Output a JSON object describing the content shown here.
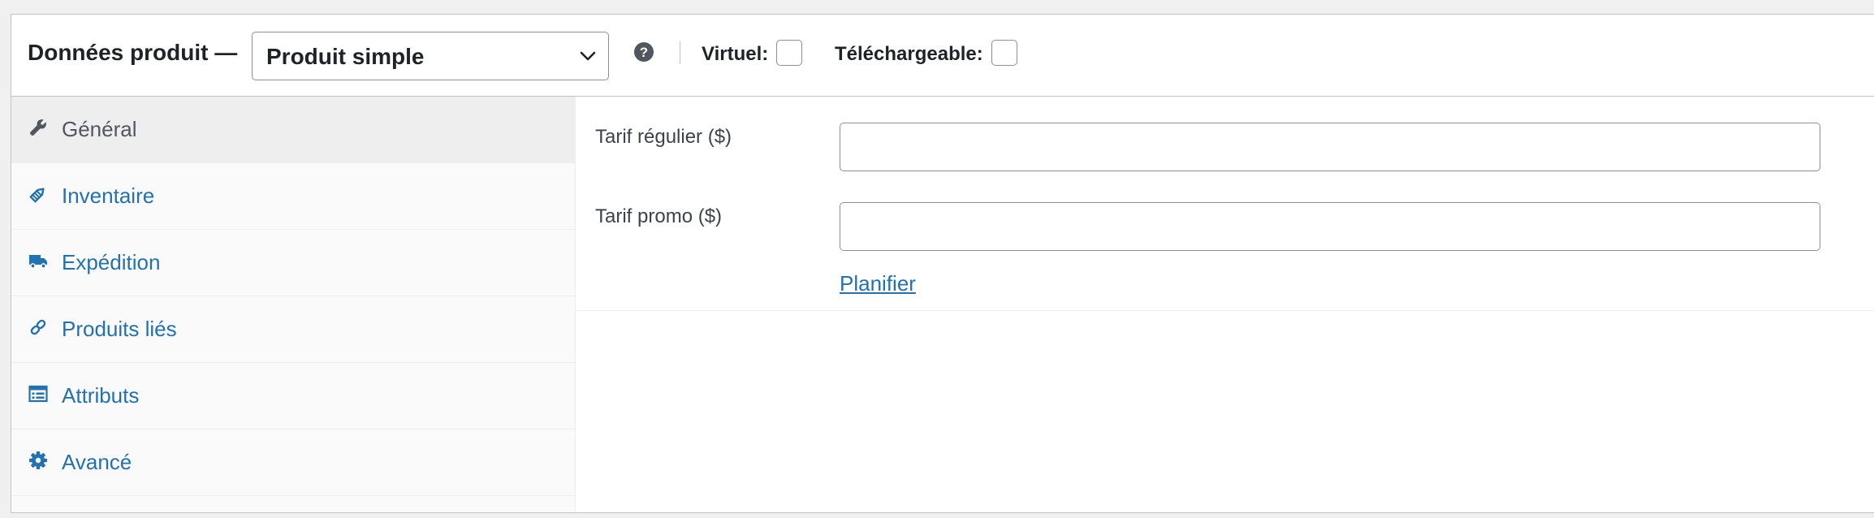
{
  "header": {
    "title": "Données produit —",
    "product_type_select": {
      "selected": "Produit simple"
    },
    "help_icon": "question-circle-icon",
    "virtual": {
      "label": "Virtuel:",
      "checked": false
    },
    "downloadable": {
      "label": "Téléchargeable:",
      "checked": false
    }
  },
  "sidebar": {
    "tabs": [
      {
        "label": "Général",
        "icon": "wrench-icon",
        "active": true
      },
      {
        "label": "Inventaire",
        "icon": "tag-icon",
        "active": false
      },
      {
        "label": "Expédition",
        "icon": "truck-icon",
        "active": false
      },
      {
        "label": "Produits liés",
        "icon": "link-icon",
        "active": false
      },
      {
        "label": "Attributs",
        "icon": "list-table-icon",
        "active": false
      },
      {
        "label": "Avancé",
        "icon": "gear-icon",
        "active": false
      }
    ]
  },
  "general": {
    "regular_price": {
      "label": "Tarif régulier ($)",
      "value": ""
    },
    "sale_price": {
      "label": "Tarif promo ($)",
      "value": ""
    },
    "schedule_link": "Planifier"
  },
  "colors": {
    "link": "#2271b1",
    "active_tab_text": "#50575e",
    "icon": "#2271b1",
    "border": "#8c8f94"
  }
}
